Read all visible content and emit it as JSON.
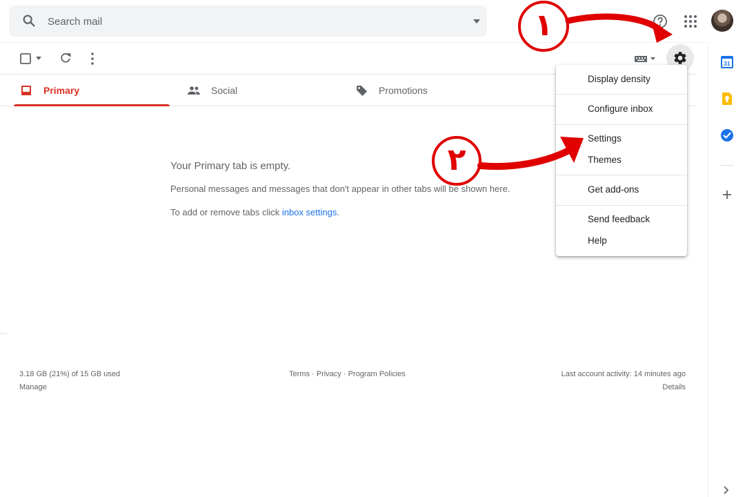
{
  "search": {
    "placeholder": "Search mail",
    "icon": "search-icon"
  },
  "header": {
    "help_icon": "help-circle-icon",
    "apps_icon": "apps-grid-icon",
    "avatar_icon": "account-avatar"
  },
  "toolbar": {
    "select_icon": "checkbox-icon",
    "refresh_icon": "refresh-icon",
    "more_icon": "more-vert-icon",
    "input_tools_icon": "keyboard-icon",
    "settings_icon": "gear-icon"
  },
  "tabs": [
    {
      "label": "Primary",
      "icon": "inbox-icon",
      "active": true
    },
    {
      "label": "Social",
      "icon": "people-icon",
      "active": false
    },
    {
      "label": "Promotions",
      "icon": "tag-icon",
      "active": false
    }
  ],
  "empty_state": {
    "title": "Your Primary tab is empty.",
    "line1": "Personal messages and messages that don't appear in other tabs will be shown here.",
    "line2_prefix": "To add or remove tabs click ",
    "line2_link": "inbox settings",
    "line2_suffix": "."
  },
  "settings_menu": {
    "items": [
      "Display density",
      "Configure inbox",
      "Settings",
      "Themes",
      "Get add-ons",
      "Send feedback",
      "Help"
    ]
  },
  "footer": {
    "storage": "3.18 GB (21%) of 15 GB used",
    "manage": "Manage",
    "terms": "Terms",
    "sep1": " · ",
    "privacy": "Privacy",
    "sep2": " · ",
    "program_policies": "Program Policies",
    "last_activity": "Last account activity: 14 minutes ago",
    "details": "Details"
  },
  "side_panel": {
    "calendar_icon": "calendar-icon",
    "calendar_day": "31",
    "keep_icon": "keep-icon",
    "tasks_icon": "tasks-icon",
    "add_icon": "plus-icon",
    "expand_icon": "chevron-right-icon"
  },
  "annotations": {
    "step1": "۱",
    "step2": "۲"
  },
  "colors": {
    "accent_red": "#d93025",
    "link_blue": "#1a73e8",
    "annotation_red": "#e00000"
  }
}
